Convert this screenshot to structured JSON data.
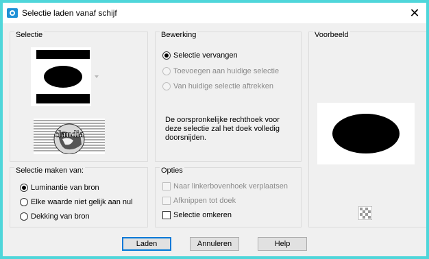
{
  "window": {
    "title": "Selectie laden vanaf schijf",
    "close_symbol": "✕"
  },
  "selectie": {
    "title": "Selectie",
    "logo_text": "claudia"
  },
  "bewerking": {
    "title": "Bewerking",
    "options": [
      {
        "label": "Selectie vervangen",
        "checked": true,
        "enabled": true
      },
      {
        "label": "Toevoegen aan huidige selectie",
        "checked": false,
        "enabled": false
      },
      {
        "label": "Van huidige selectie aftrekken",
        "checked": false,
        "enabled": false
      }
    ],
    "description": "De oorspronkelijke rechthoek voor deze selectie zal het doek volledig doorsnijden."
  },
  "voorbeeld": {
    "title": "Voorbeeld"
  },
  "maken_van": {
    "title": "Selectie maken van:",
    "options": [
      {
        "label": "Luminantie van bron",
        "checked": true
      },
      {
        "label": "Elke waarde niet gelijk aan nul",
        "checked": false
      },
      {
        "label": "Dekking van bron",
        "checked": false
      }
    ]
  },
  "opties": {
    "title": "Opties",
    "options": [
      {
        "label": "Naar linkerbovenhoek verplaatsen",
        "checked": false,
        "enabled": false
      },
      {
        "label": "Afknippen tot doek",
        "checked": false,
        "enabled": false
      },
      {
        "label": "Selectie omkeren",
        "checked": false,
        "enabled": true
      }
    ]
  },
  "buttons": {
    "load": "Laden",
    "cancel": "Annuleren",
    "help": "Help"
  },
  "colors": {
    "frame": "#4fd6da",
    "accent": "#0078d7"
  }
}
